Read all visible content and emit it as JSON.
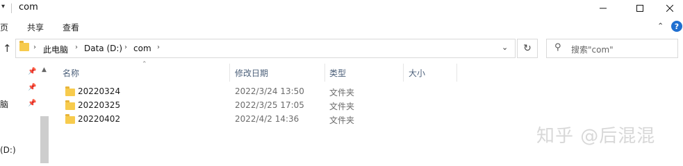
{
  "window": {
    "title": "com"
  },
  "ribbon": {
    "tabs": [
      "页",
      "共享",
      "查看"
    ]
  },
  "address": {
    "crumbs": [
      "此电脑",
      "Data (D:)",
      "com"
    ],
    "search_placeholder": "搜索\"com\""
  },
  "nav": {
    "items": [
      "脑",
      "(D:)"
    ]
  },
  "columns": {
    "name": "名称",
    "date": "修改日期",
    "type": "类型",
    "size": "大小"
  },
  "files": [
    {
      "name": "20220324",
      "date": "2022/3/24 13:50",
      "type": "文件夹"
    },
    {
      "name": "20220325",
      "date": "2022/3/25 17:05",
      "type": "文件夹"
    },
    {
      "name": "20220402",
      "date": "2022/4/2 14:36",
      "type": "文件夹"
    }
  ],
  "watermark": "知乎 @后混混",
  "colors": {
    "folder": "#f7cb4d",
    "help": "#1f6fd0",
    "header_text": "#4c607a"
  }
}
